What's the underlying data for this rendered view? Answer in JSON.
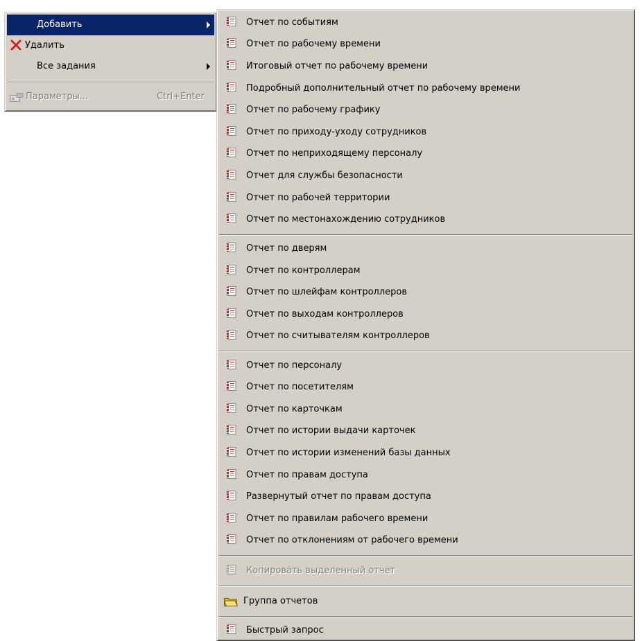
{
  "main_menu": {
    "items": [
      {
        "label": "Добавить"
      },
      {
        "label": "Удалить"
      },
      {
        "label": "Все задания"
      },
      {
        "label": "Параметры...",
        "accel": "Ctrl+Enter"
      }
    ]
  },
  "submenu": {
    "group1": [
      "Отчет по событиям",
      "Отчет по рабочему времени",
      "Итоговый отчет по рабочему времени",
      "Подробный дополнительный отчет по рабочему времени",
      "Отчет по рабочему графику",
      "Отчет по приходу-уходу сотрудников",
      "Отчет по неприходящему персоналу",
      "Отчет для службы безопасности",
      "Отчет по рабочей территории",
      "Отчет по местонахождению сотрудников"
    ],
    "group2": [
      "Отчет по дверям",
      "Отчет по контроллерам",
      "Отчет по шлейфам контроллеров",
      "Отчет по выходам контроллеров",
      "Отчет по считывателям контроллеров"
    ],
    "group3": [
      "Отчет по персоналу",
      "Отчет по посетителям",
      "Отчет по карточкам",
      "Отчет по истории выдачи карточек",
      "Отчет по истории изменений базы данных",
      "Отчет по правам доступа",
      "Развернутый отчет по правам доступа",
      "Отчет по правилам рабочего времени",
      "Отчет по отклонениям от рабочего времени"
    ],
    "copy_report": "Копировать выделенный отчет",
    "report_group": "Группа отчетов",
    "quick_query": "Быстрый запрос"
  },
  "colors": {
    "menu_bg": "#d4d0c8",
    "highlight": "#0a246a",
    "icon_red": "#cc1f1f",
    "disabled": "#808080",
    "folder_yellow": "#f2d24a"
  },
  "icons": {
    "report": "report-icon",
    "delete": "delete-x-icon",
    "params": "parameters-icon",
    "folder": "folder-icon",
    "submenu_arrow": "chevron-right-icon"
  }
}
